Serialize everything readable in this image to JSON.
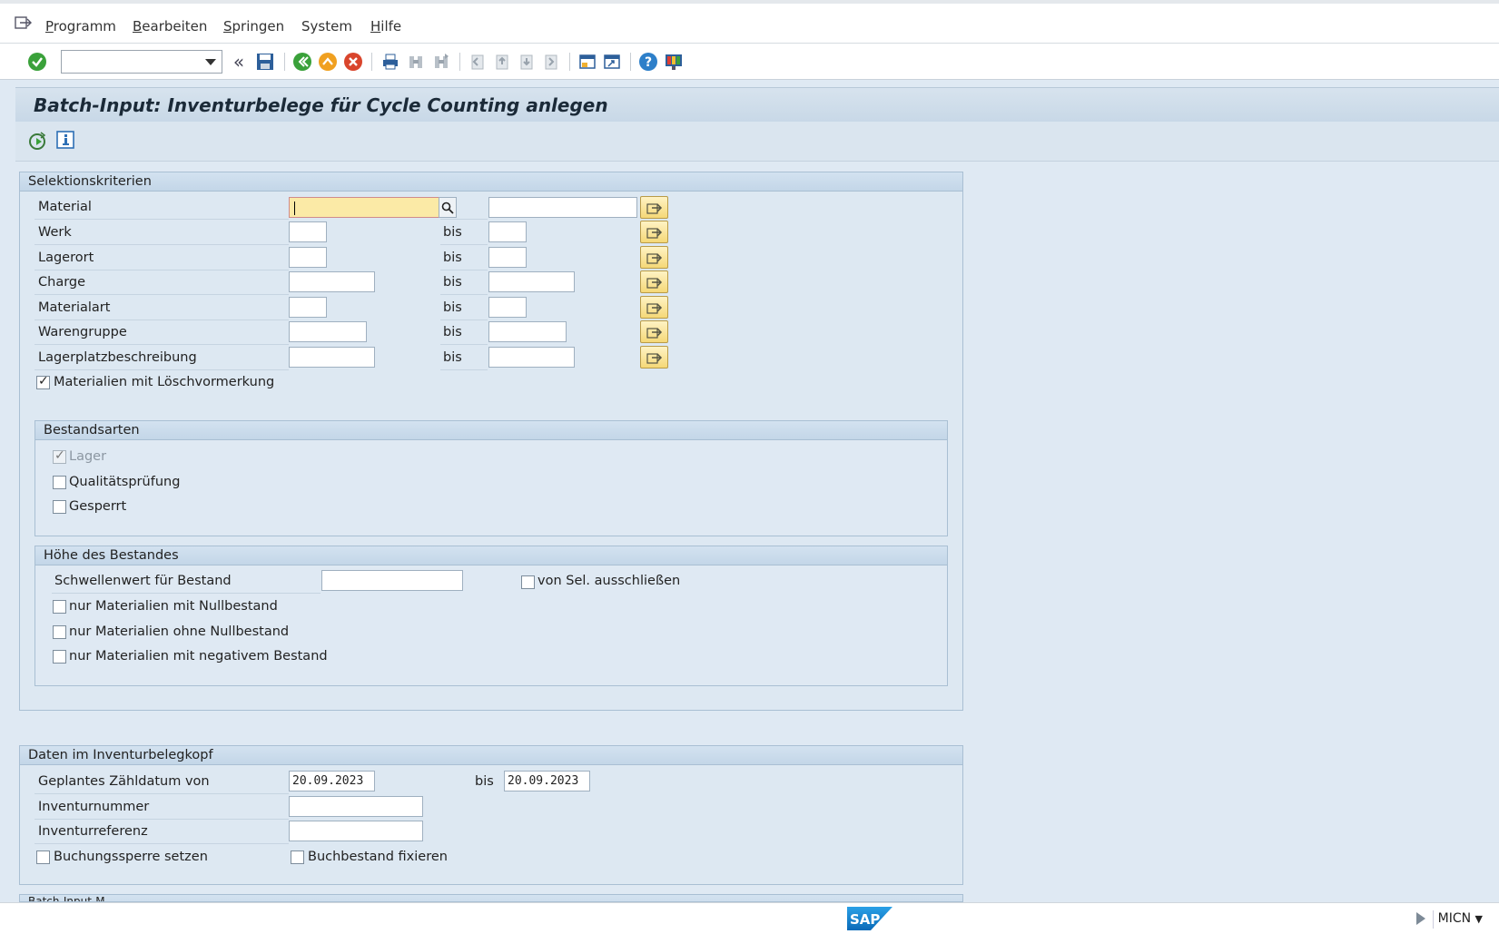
{
  "menu": {
    "items": [
      {
        "key": "P",
        "rest": "rogramm"
      },
      {
        "key": "B",
        "rest": "earbeiten"
      },
      {
        "key": "S",
        "rest": "pringen"
      },
      {
        "key": "",
        "rest": "System"
      },
      {
        "key": "H",
        "rest": "ilfe"
      }
    ]
  },
  "title": "Batch-Input: Inventurbelege für Cycle Counting anlegen",
  "selection": {
    "header": "Selektionskriterien",
    "bis": "bis",
    "rows": [
      {
        "label": "Material"
      },
      {
        "label": "Werk"
      },
      {
        "label": "Lagerort"
      },
      {
        "label": "Charge"
      },
      {
        "label": "Materialart"
      },
      {
        "label": "Warengruppe"
      },
      {
        "label": "Lagerplatzbeschreibung"
      }
    ],
    "deletion_flag_label": "Materialien mit Löschvormerkung",
    "stock_types": {
      "header": "Bestandsarten",
      "lager": "Lager",
      "quality": "Qualitätsprüfung",
      "blocked": "Gesperrt"
    },
    "stock_level": {
      "header": "Höhe des Bestandes",
      "threshold": "Schwellenwert für Bestand",
      "exclude": "von Sel. ausschließen",
      "zero": "nur Materialien mit Nullbestand",
      "nonzero": "nur Materialien ohne Nullbestand",
      "negative": "nur Materialien mit negativem Bestand"
    }
  },
  "header_data": {
    "header": "Daten im Inventurbelegkopf",
    "count_date_label": "Geplantes Zähldatum von",
    "count_date_from": "20.09.2023",
    "bis": "bis",
    "count_date_to": "20.09.2023",
    "inventory_number": "Inventurnummer",
    "inventory_reference": "Inventurreferenz",
    "posting_block": "Buchungssperre setzen",
    "freeze_book": "Buchbestand fixieren"
  },
  "partial_group_header": "Batch-Input-M",
  "status": {
    "system": "MICN"
  },
  "colors": {
    "accent": "#f0c050",
    "focus_field": "#fbeaa6",
    "background": "#dfe9f3"
  }
}
